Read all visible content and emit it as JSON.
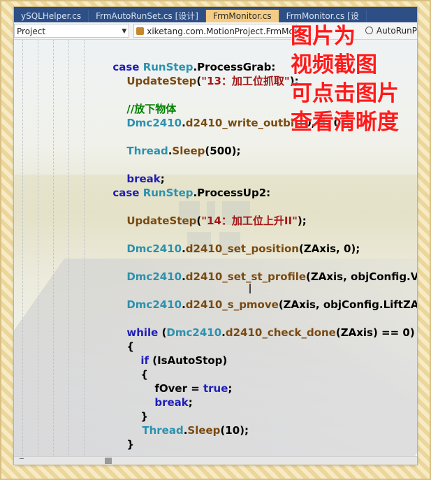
{
  "tabs": [
    {
      "label": "ySQLHelper.cs",
      "active": false
    },
    {
      "label": "FrmAutoRunSet.cs [设计]",
      "active": false
    },
    {
      "label": "FrmMonitor.cs",
      "active": true
    },
    {
      "label": "FrmMonitor.cs [设",
      "active": false
    }
  ],
  "navbar": {
    "project": "Project",
    "class_path": "xiketang.com.MotionProject.FrmMonitor",
    "method": "AutoRunP"
  },
  "caption": {
    "line1": "图片为",
    "line2": "视频截图",
    "line3": "可点击图片",
    "line4": "查看清晰度"
  },
  "code": {
    "l1": {
      "kw": "case ",
      "ty": "RunStep",
      "rest": ".ProcessGrab:"
    },
    "l2": {
      "mb": "UpdateStep",
      "p1": "(",
      "st": "\"13：加工位抓取\"",
      "p2": ");"
    },
    "l3": {
      "cm": "//放下物体"
    },
    "l4": {
      "ty": "Dmc2410",
      "p1": ".",
      "mb": "d2410_write_outbit",
      "p2": "(0, 5, 0);"
    },
    "l5": {
      "ty": "Thread",
      "p1": ".",
      "mb": "Sleep",
      "p2": "(500);"
    },
    "l6": {
      "kw": "break",
      "p1": ";"
    },
    "l7": {
      "kw": "case ",
      "ty": "RunStep",
      "rest": ".ProcessUp2:"
    },
    "l8": {
      "mb": "UpdateStep",
      "p1": "(",
      "st": "\"14：加工位上升II\"",
      "p2": ");"
    },
    "l9": {
      "ty": "Dmc2410",
      "p1": ".",
      "mb": "d2410_set_position",
      "p2": "(ZAxis, 0);"
    },
    "l10": {
      "ty": "Dmc2410",
      "p1": ".",
      "mb": "d2410_set_st_profile",
      "p2": "(ZAxis, objConfig.Ve"
    },
    "l11": {
      "ty": "Dmc2410",
      "p1": ".",
      "mb": "d2410_s_pmove",
      "p2": "(ZAxis, objConfig.LiftZAx"
    },
    "l12": {
      "kw": "while ",
      "p0": "(",
      "ty": "Dmc2410",
      "p1": ".",
      "mb": "d2410_check_done",
      "p2": "(ZAxis) == 0)"
    },
    "l13": {
      "p1": "{"
    },
    "l14": {
      "kw": "if ",
      "p1": "(IsAutoStop)"
    },
    "l15": {
      "p1": "{"
    },
    "l16": {
      "p0": "fOver = ",
      "kw": "true",
      "p1": ";"
    },
    "l17": {
      "kw": "break",
      "p1": ";"
    },
    "l18": {
      "p1": "}"
    },
    "l19": {
      "ty": "Thread",
      "p1": ".",
      "mb": "Sleep",
      "p2": "(10);"
    },
    "l20": {
      "p1": "}"
    },
    "l21": {
      "kw": "break",
      "p1": ";"
    }
  },
  "colors": {
    "keyword": "#1f1fb8",
    "type": "#2b91af",
    "string": "#a31515",
    "comment": "#008000",
    "caption": "#ff1a1a",
    "tab_active": "#f5cc84",
    "tab_bar": "#2d4f86"
  }
}
